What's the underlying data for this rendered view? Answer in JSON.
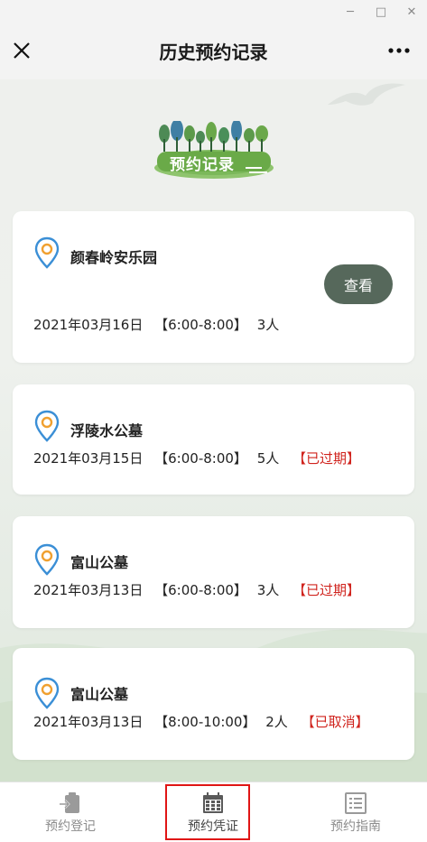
{
  "window": {
    "minimize_glyph": "─",
    "maximize_glyph": "□",
    "close_glyph": "✕"
  },
  "header": {
    "title": "历史预约记录"
  },
  "banner": {
    "title": "预约记录"
  },
  "records": [
    {
      "place": "颜春岭安乐园",
      "date": "2021年03月16日",
      "slot": "【6:00-8:00】",
      "people": "3人",
      "status": "",
      "action": "查看"
    },
    {
      "place": "浮陵水公墓",
      "date": "2021年03月15日",
      "slot": "【6:00-8:00】",
      "people": "5人",
      "status": "【已过期】"
    },
    {
      "place": "富山公墓",
      "date": "2021年03月13日",
      "slot": "【6:00-8:00】",
      "people": "3人",
      "status": "【已过期】"
    },
    {
      "place": "富山公墓",
      "date": "2021年03月13日",
      "slot": "【8:00-10:00】",
      "people": "2人",
      "status": "【已取消】"
    }
  ],
  "tabbar": {
    "tabs": [
      {
        "label": "预约登记",
        "icon": "clipboard-arrow-icon"
      },
      {
        "label": "预约凭证",
        "icon": "calendar-icon",
        "selected": true
      },
      {
        "label": "预约指南",
        "icon": "list-document-icon"
      }
    ]
  },
  "colors": {
    "accent_button": "#56685b",
    "status_red": "#d0241e",
    "pin_blue": "#3b8fd6",
    "pin_orange": "#f0a030",
    "selected_outline": "#e01515"
  }
}
